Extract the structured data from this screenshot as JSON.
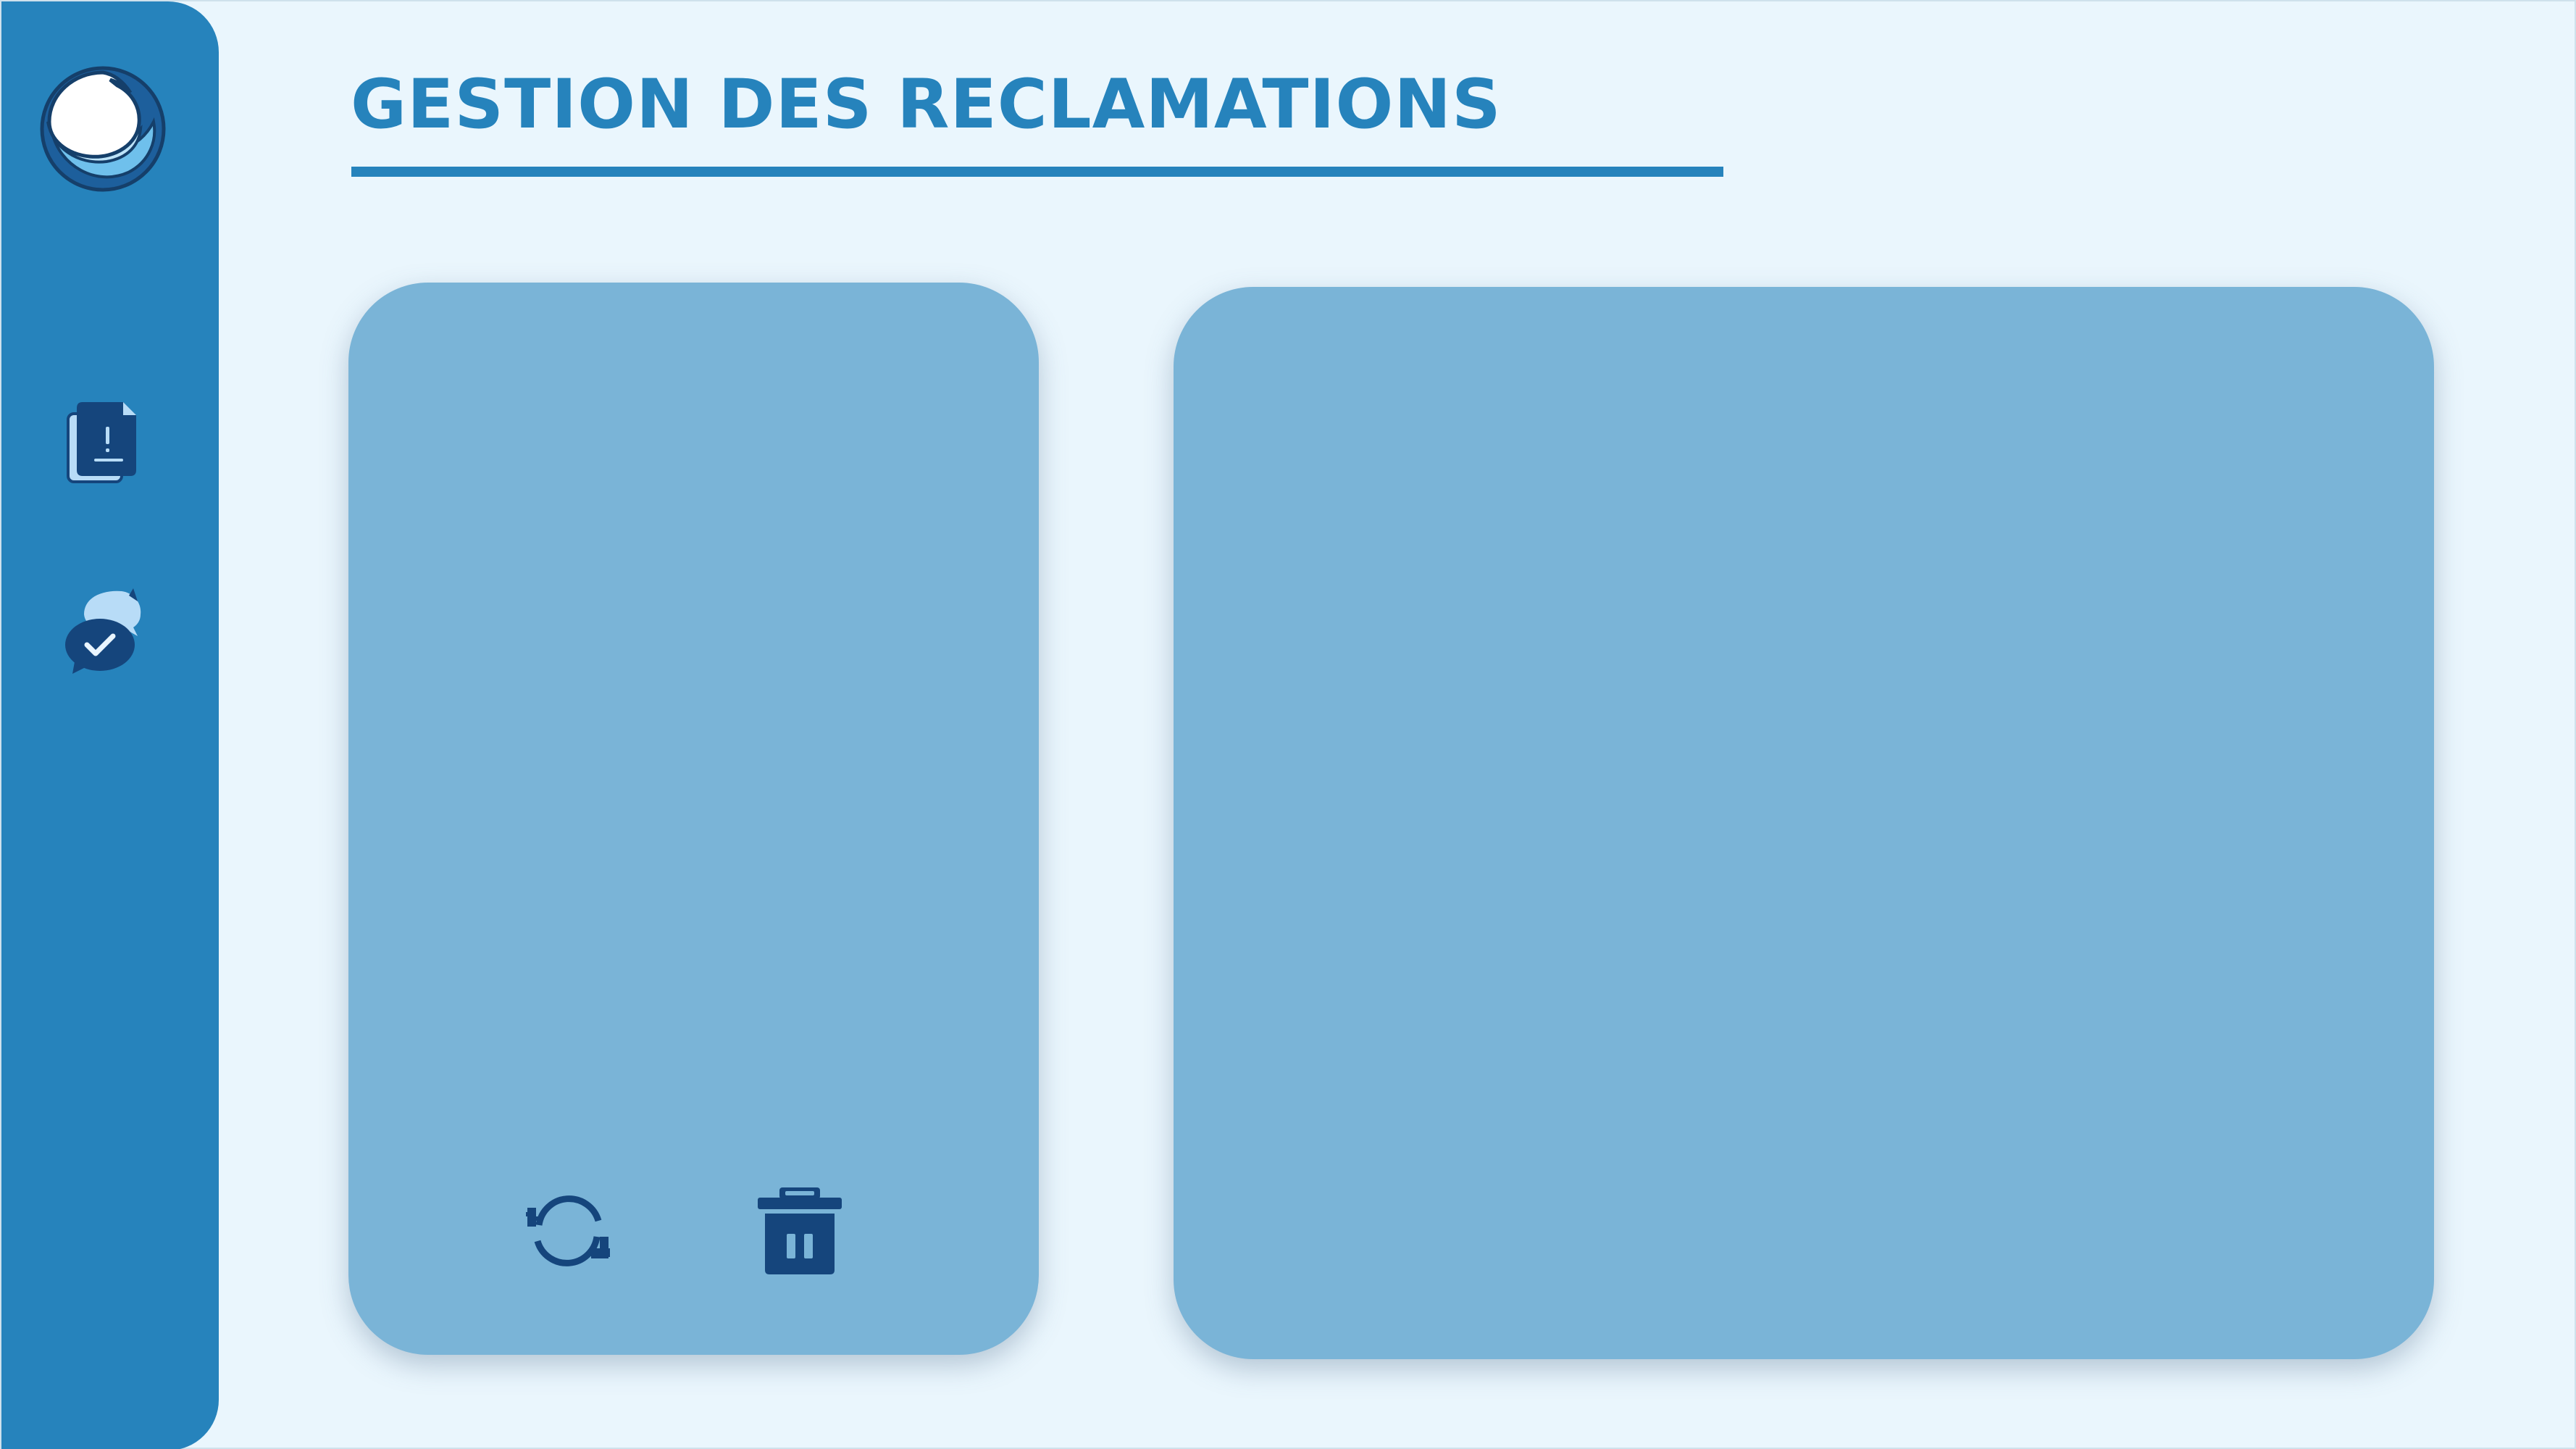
{
  "header": {
    "title": "GESTION DES RECLAMATIONS"
  },
  "sidebar": {
    "logo_icon": "globe-wave-logo",
    "items": [
      {
        "icon": "document-alert-icon",
        "name": "reclamations"
      },
      {
        "icon": "chat-check-icon",
        "name": "messages"
      }
    ]
  },
  "panels": {
    "left": {
      "actions": [
        {
          "icon": "refresh-icon"
        },
        {
          "icon": "trash-icon"
        }
      ]
    },
    "right": {}
  },
  "colors": {
    "background": "#eaf6fd",
    "sidebar": "#2683bc",
    "accent": "#2683bc",
    "panel": "#7ab4d7",
    "icon_dark": "#15457c",
    "icon_light": "#b8dcf7"
  }
}
